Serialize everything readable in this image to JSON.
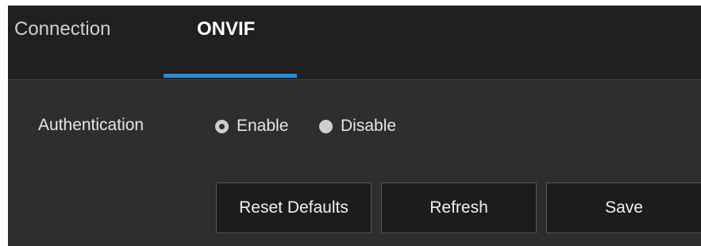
{
  "tabs": [
    {
      "label": "Connection",
      "active": false
    },
    {
      "label": "ONVIF",
      "active": true
    }
  ],
  "accent_color": "#2b8fd8",
  "authentication": {
    "label": "Authentication",
    "options": [
      {
        "label": "Enable",
        "selected": true
      },
      {
        "label": "Disable",
        "selected": false
      }
    ]
  },
  "buttons": {
    "reset_defaults": "Reset Defaults",
    "refresh": "Refresh",
    "save": "Save"
  }
}
